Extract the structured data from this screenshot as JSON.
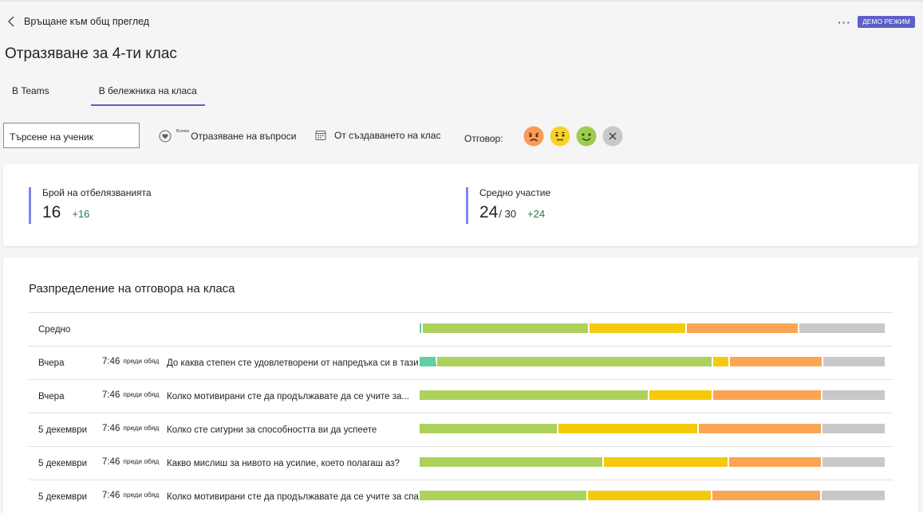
{
  "nav": {
    "back_label": "Връщане към общ преглед",
    "more_label": "···",
    "demo_badge": "ДЕМО РЕЖИМ"
  },
  "page": {
    "title": "Отразяване за 4-ти клас"
  },
  "tabs": [
    {
      "label": "В Teams"
    },
    {
      "label": "В бележника на класа"
    }
  ],
  "filters": {
    "search_value": "Търсене на ученик",
    "reflect_tiny": "Всички",
    "reflect_label": "Отразяване на въпроси",
    "date_label": "От създаването на клас",
    "response_label": "Отговор:"
  },
  "faces": [
    {
      "name": "sad",
      "color": "#f79a5b"
    },
    {
      "name": "neutral",
      "color": "#f8d22a"
    },
    {
      "name": "happy",
      "color": "#9fcb4f"
    },
    {
      "name": "clear",
      "color": "#c8c8c8"
    }
  ],
  "stats": {
    "checkins_label": "Брой на отбелязванията",
    "checkins_value": "16",
    "checkins_delta": "+16",
    "participation_label": "Средно участие",
    "participation_value": "24",
    "participation_total": "/ 30",
    "participation_delta": "+24"
  },
  "distribution": {
    "title": "Разпределение на отговора на класа",
    "colors": {
      "teal": "#5fd0a0",
      "green": "#add15d",
      "yellow": "#f5ca0c",
      "orange": "#fba453",
      "gray": "#c8c8c8"
    },
    "rows": [
      {
        "date": "Средно",
        "time": "",
        "period": "",
        "question": "",
        "segments": [
          [
            "teal",
            0.3
          ],
          [
            "green",
            35.8
          ],
          [
            "yellow",
            20.7
          ],
          [
            "orange",
            24.0
          ],
          [
            "gray",
            18.5
          ]
        ]
      },
      {
        "date": "Вчера",
        "time": "7:46",
        "period": "преди обяд",
        "question": "До каква степен сте удовлетворени от напредъка си в тази плак",
        "segments": [
          [
            "teal",
            3.4
          ],
          [
            "green",
            59.6
          ],
          [
            "yellow",
            3.4
          ],
          [
            "orange",
            19.8
          ],
          [
            "gray",
            13.4
          ]
        ]
      },
      {
        "date": "Вчера",
        "time": "7:46",
        "period": "преди обяд",
        "question": "Колко мотивирани сте да продължавате да се учите за...",
        "segments": [
          [
            "green",
            49.4
          ],
          [
            "yellow",
            13.4
          ],
          [
            "orange",
            23.2
          ],
          [
            "gray",
            13.5
          ]
        ]
      },
      {
        "date": "5 декември",
        "time": "7:46",
        "period": "преди обяд",
        "question": "Колко сте сигурни за способността ви да успеете",
        "segments": [
          [
            "green",
            29.7
          ],
          [
            "yellow",
            29.9
          ],
          [
            "orange",
            26.5
          ],
          [
            "gray",
            13.4
          ]
        ]
      },
      {
        "date": "5 декември",
        "time": "7:46",
        "period": "преди обяд",
        "question": "Какво мислиш за нивото на усилие, което полагаш аз?",
        "segments": [
          [
            "green",
            39.6
          ],
          [
            "yellow",
            26.6
          ],
          [
            "orange",
            20.0
          ],
          [
            "gray",
            13.4
          ]
        ]
      },
      {
        "date": "5 декември",
        "time": "7:46",
        "period": "преди обяд",
        "question": "Колко мотивирани сте да продължавате да се учите за спа",
        "segments": [
          [
            "green",
            36.0
          ],
          [
            "yellow",
            26.6
          ],
          [
            "orange",
            23.2
          ],
          [
            "gray",
            13.6
          ]
        ]
      }
    ]
  }
}
